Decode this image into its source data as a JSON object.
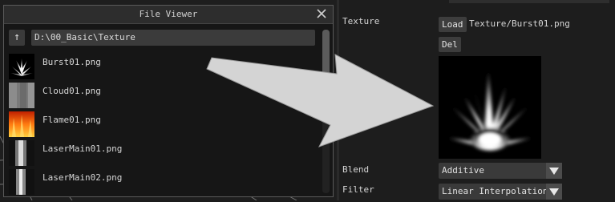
{
  "file_viewer": {
    "title": "File Viewer",
    "path": "D:\\00_Basic\\Texture",
    "up_symbol": "↑",
    "files": [
      {
        "name": "Burst01.png",
        "thumb": "burst-thumbnail"
      },
      {
        "name": "Cloud01.png",
        "thumb": "cloud-thumbnail"
      },
      {
        "name": "Flame01.png",
        "thumb": "flame-thumbnail"
      },
      {
        "name": "LaserMain01.png",
        "thumb": "laser-thumbnail"
      },
      {
        "name": "LaserMain02.png",
        "thumb": "laser-thumbnail"
      }
    ]
  },
  "inspector": {
    "texture_label": "Texture",
    "load_label": "Load",
    "del_label": "Del",
    "texture_path": "Texture/Burst01.png",
    "blend_label": "Blend",
    "blend_value": "Additive",
    "filter_label": "Filter",
    "filter_value": "Linear Interpolation"
  },
  "colors": {
    "panel_bg": "#1d1d1d",
    "button_bg": "#3d3d3d",
    "arrow_fill": "#d4d4d4"
  }
}
